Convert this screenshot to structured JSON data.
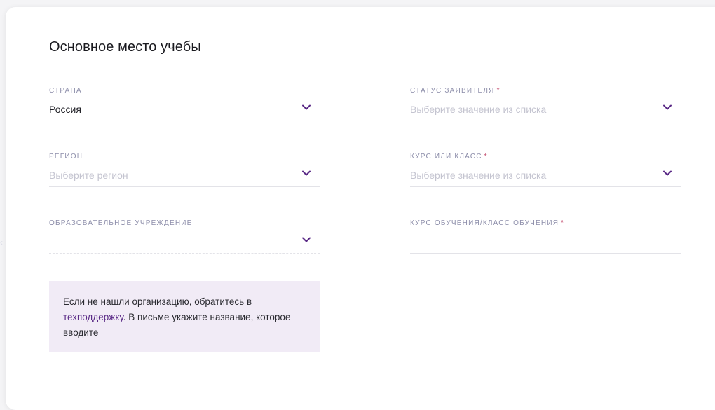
{
  "section": {
    "title": "Основное место учебы"
  },
  "fields": {
    "country": {
      "label": "СТРАНА",
      "value": "Россия",
      "required": false
    },
    "region": {
      "label": "РЕГИОН",
      "placeholder": "Выберите регион",
      "required": false
    },
    "institution": {
      "label": "ОБРАЗОВАТЕЛЬНОЕ УЧРЕЖДЕНИЕ",
      "value": "",
      "required": false
    },
    "applicant_status": {
      "label": "СТАТУС ЗАЯВИТЕЛЯ",
      "required_mark": "*",
      "placeholder": "Выберите значение из списка"
    },
    "course_or_class": {
      "label": "КУРС ИЛИ КЛАСС",
      "required_mark": "*",
      "placeholder": "Выберите значение из списка"
    },
    "course_of_study": {
      "label": "КУРС ОБУЧЕНИЯ/КЛАСС ОБУЧЕНИЯ",
      "required_mark": "*",
      "value": ""
    }
  },
  "notice": {
    "text_before": "Если не нашли организацию, обратитесь в ",
    "link_text": "техподдержку",
    "text_after": ". В письме укажите название, которое вводите"
  },
  "icons": {
    "dropdown": "chevron-down-icon"
  },
  "colors": {
    "accent": "#5a2a86",
    "label": "#8d8eaa",
    "required": "#c2476a",
    "notice_bg": "#f1ebf6"
  }
}
